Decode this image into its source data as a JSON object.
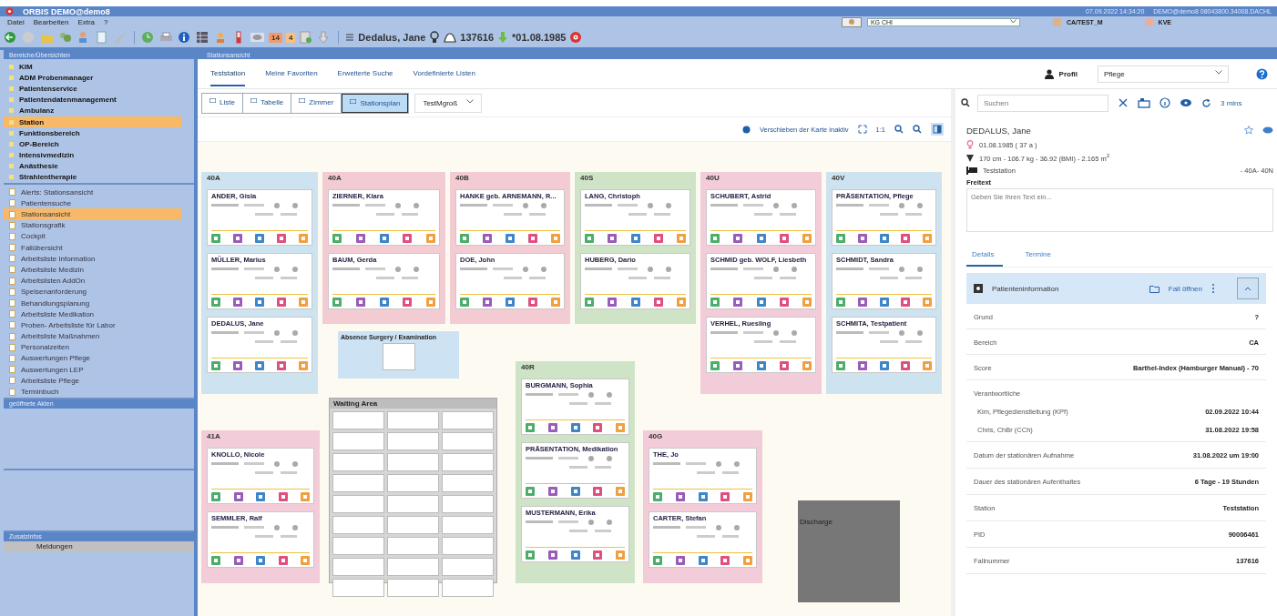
{
  "window": {
    "title": "ORBIS DEMO@demo8",
    "datetime": "07.09.2022 14:34:20",
    "session": "DEMO@demo8 08043800.34008.DACHL"
  },
  "menu": [
    "Datei",
    "Bearbeiten",
    "Extra",
    "?"
  ],
  "toolbar": {
    "counters": [
      {
        "text": "14",
        "color": "#f39a6a"
      },
      {
        "text": "4",
        "color": "#f8c27e"
      }
    ],
    "patient_name": "Dedalus, Jane",
    "case_number": "137616",
    "birth_date": "*01.08.1985"
  },
  "context": {
    "department": "KG CHI",
    "unit": "CA/TEST_M",
    "role": "KVE"
  },
  "sidebar": {
    "title": "Bereiche/Übersichten",
    "areas": [
      {
        "label": "KIM",
        "selected": false
      },
      {
        "label": "ADM Probenmanager",
        "selected": false
      },
      {
        "label": "Patientenservice",
        "selected": false
      },
      {
        "label": "Patientendatenmanagement",
        "selected": false
      },
      {
        "label": "Ambulanz",
        "selected": false
      },
      {
        "label": "Station",
        "selected": true
      },
      {
        "label": "Funktionsbereich",
        "selected": false
      },
      {
        "label": "OP-Bereich",
        "selected": false
      },
      {
        "label": "Intensivmedizin",
        "selected": false
      },
      {
        "label": "Anästhesie",
        "selected": false
      },
      {
        "label": "Strahlentherapie",
        "selected": false
      }
    ],
    "views": [
      {
        "label": "Alerts: Stationsansicht",
        "selected": false
      },
      {
        "label": "Patientensuche",
        "selected": false
      },
      {
        "label": "Stationsansicht",
        "selected": true
      },
      {
        "label": "Stationsgrafik",
        "selected": false
      },
      {
        "label": "Cockpit",
        "selected": false
      },
      {
        "label": "Fallübersicht",
        "selected": false
      },
      {
        "label": "Arbeitsliste Information",
        "selected": false
      },
      {
        "label": "Arbeitsliste Medizin",
        "selected": false
      },
      {
        "label": "Arbeitslisten AddOn",
        "selected": false
      },
      {
        "label": "Speisenanforderung",
        "selected": false
      },
      {
        "label": "Behandlungsplanung",
        "selected": false
      },
      {
        "label": "Arbeitsliste Medikation",
        "selected": false
      },
      {
        "label": "Proben- Arbeitsliste für Labor",
        "selected": false
      },
      {
        "label": "Arbeitsliste Maßnahmen",
        "selected": false
      },
      {
        "label": "Personalzeiten",
        "selected": false
      },
      {
        "label": "Auswertungen Pflege",
        "selected": false
      },
      {
        "label": "Auswertungen LEP",
        "selected": false
      },
      {
        "label": "Arbeitsliste Pflege",
        "selected": false
      },
      {
        "label": "Terminbuch",
        "selected": false
      }
    ],
    "open_records_title": "geöffnete Akten",
    "extra_title": "Zusatzinfos",
    "extra_items": [
      "Meldungen"
    ]
  },
  "page_title": "Stationsansicht",
  "tabs": [
    {
      "label": "Teststation",
      "selected": true
    },
    {
      "label": "Meine Favoriten",
      "selected": false
    },
    {
      "label": "Erweiterte Suche",
      "selected": false
    },
    {
      "label": "Vordefinierte Listen",
      "selected": false
    }
  ],
  "views": [
    {
      "label": "Liste",
      "selected": false
    },
    {
      "label": "Tabelle",
      "selected": false
    },
    {
      "label": "Zimmer",
      "selected": false
    },
    {
      "label": "Stationsplan",
      "selected": true
    }
  ],
  "layout_select": "TestMgroß",
  "map_toolbar": {
    "pan_label": "Verschieben der Karte inaktiv",
    "scale": "1:1"
  },
  "rooms": [
    {
      "label": "40A",
      "color": "#cde3ef",
      "patients": [
        "ANDER, Gisla",
        "MÜLLER, Marius",
        "DEDALUS, Jane"
      ]
    },
    {
      "label": "40A",
      "color": "#f3ccd3",
      "patients": [
        "ZIERNER, Klara",
        "BAUM, Gerda"
      ]
    },
    {
      "label": "40B",
      "color": "#f3ccd3",
      "patients": [
        "HANKE geb. ARNEMANN, R...",
        "DOE, John"
      ]
    },
    {
      "label": "40S",
      "color": "#cfe3c6",
      "patients": [
        "LANG, Christoph",
        "HUBERG, Dario"
      ]
    },
    {
      "label": "40U",
      "color": "#f3ccd9",
      "patients": [
        "SCHUBERT, Astrid",
        "SCHMID geb. WOLF, Liesbeth",
        "VERHEL, Ruesling"
      ]
    },
    {
      "label": "40V",
      "color": "#cde3ef",
      "patients": [
        "PRÄSENTATION, Pflege",
        "SCHMIDT, Sandra",
        "SCHMITA, Testpatient"
      ]
    },
    {
      "label": "41A",
      "color": "#f3ccd9",
      "patients": [
        "KNOLLO, Nicole",
        "SEMMLER, Ralf"
      ]
    },
    {
      "label": "40R",
      "color": "#cfe3c6",
      "patients": [
        "BURGMANN, Sophia",
        "PRÄSENTATION, Medikation",
        "MUSTERMANN, Erika"
      ]
    },
    {
      "label": "40G",
      "color": "#f3ccd9",
      "patients": [
        "THE, Jo",
        "CARTER, Stefan"
      ]
    }
  ],
  "absence": {
    "title": "Absence Surgery / Examination"
  },
  "waiting_area": {
    "title": "Waiting Area"
  },
  "discharge": {
    "title": "Discharge"
  },
  "profile": {
    "label": "Profil",
    "value": "Pflege"
  },
  "search": {
    "placeholder": "Suchen",
    "refresh": "3 mins"
  },
  "patient": {
    "name": "DEDALUS, Jane",
    "birth": "01.08.1985 ( 37 a )",
    "measures": "170 cm - 106.7 kg - 36.92 (BMI) - 2.165 m$^{2}$",
    "station": "Teststation",
    "beds": "- 40A- 40N",
    "note_label": "Freitext",
    "note_placeholder": "Geben Sie Ihren Text ein..."
  },
  "detail_tabs": [
    {
      "label": "Details",
      "selected": true
    },
    {
      "label": "Termine",
      "selected": false
    }
  ],
  "info": {
    "title": "Patienteninformation",
    "open_case": "Fall öffnen",
    "expanded": true,
    "rows": [
      {
        "label": "Grund",
        "value": "?"
      },
      {
        "label": "Bereich",
        "value": "CA"
      },
      {
        "label": "Score",
        "value": "Barthel-Index (Hamburger Manual) - 70"
      }
    ],
    "responsible_title": "Verantwortliche",
    "responsible": [
      {
        "name": "Kim, Pflegedienstleitung (KPf)",
        "time": "02.09.2022 10:44"
      },
      {
        "name": "Chris, ChBr (CCh)",
        "time": "31.08.2022 19:58"
      }
    ],
    "rows2": [
      {
        "label": "Datum der stationären Aufnahme",
        "value": "31.08.2022 um 19:00"
      },
      {
        "label": "Dauer des stationären Aufenthaltes",
        "value": "6 Tage - 19 Stunden"
      },
      {
        "label": "Station",
        "value": "Teststation"
      },
      {
        "label": "PID",
        "value": "90006461"
      },
      {
        "label": "Fallnummer",
        "value": "137616"
      }
    ]
  }
}
